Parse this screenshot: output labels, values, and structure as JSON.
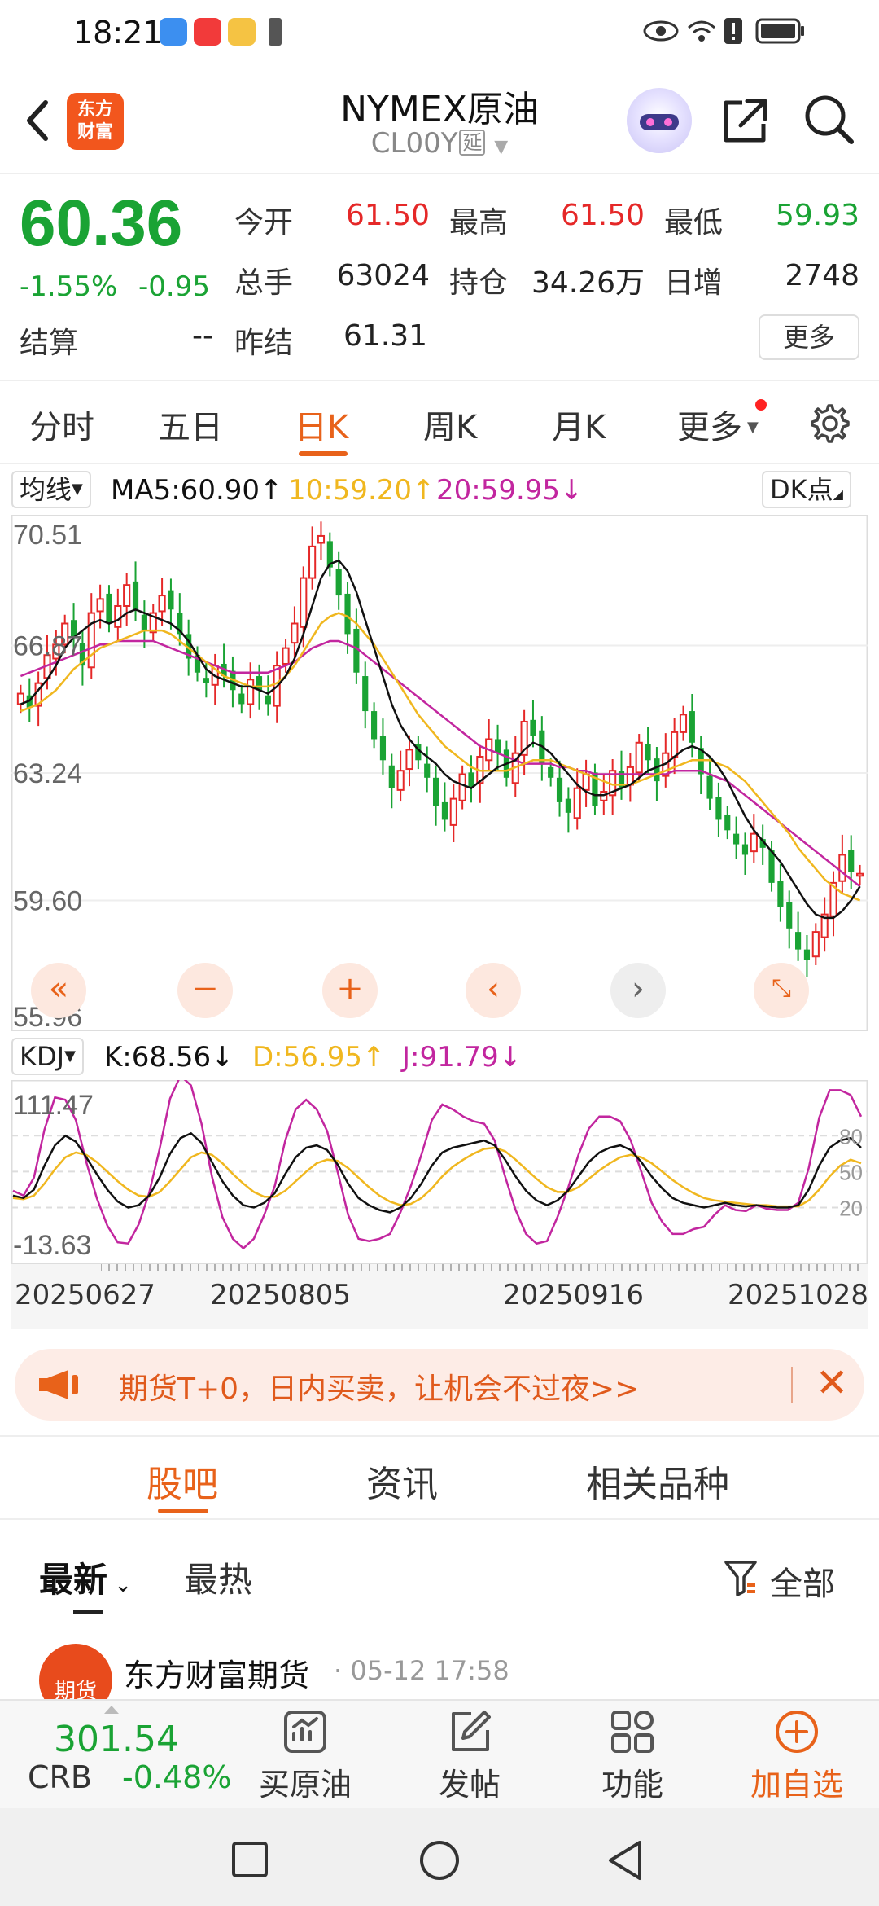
{
  "status_bar": {
    "time": "18:21",
    "app_icons": [
      "maps-app-icon",
      "xiaohongshu-app-icon",
      "xiaohongshu-app-icon",
      "weibo-app-icon",
      "sim-icon"
    ],
    "right_icons": [
      "eye-icon",
      "wifi-icon",
      "alert-icon",
      "battery-icon"
    ]
  },
  "header": {
    "logo_text_1": "东方",
    "logo_text_2": "财富",
    "title": "NYMEX原油",
    "code": "CL00Y",
    "delay_tag": "延"
  },
  "quote": {
    "price": "60.36",
    "change_pct": "-1.55%",
    "change": "-0.95",
    "open_label": "今开",
    "open": "61.50",
    "high_label": "最高",
    "high": "61.50",
    "low_label": "最低",
    "low": "59.93",
    "volume_label": "总手",
    "volume": "63024",
    "oi_label": "持仓",
    "oi": "34.26万",
    "oi_change_label": "日增",
    "oi_change": "2748",
    "settle_label": "结算",
    "settle": "--",
    "prev_settle_label": "昨结",
    "prev_settle": "61.31",
    "more_label": "更多"
  },
  "period_tabs": [
    {
      "label": "分时"
    },
    {
      "label": "五日"
    },
    {
      "label": "日K"
    },
    {
      "label": "周K"
    },
    {
      "label": "月K"
    },
    {
      "label": "更多"
    }
  ],
  "active_period": "日K",
  "ma_row": {
    "selector": "均线",
    "ma5": "MA5:60.90↑",
    "ma10": "10:59.20↑",
    "ma20": "20:59.95↓",
    "dk": "DK点"
  },
  "kdj_row": {
    "selector": "KDJ",
    "k": "K:68.56↓",
    "d": "D:56.95↑",
    "j": "J:91.79↓"
  },
  "chart_labels": {
    "price_ticks": [
      "70.51",
      "66.87",
      "63.24",
      "59.60",
      "55.96"
    ],
    "kdj_ticks_left": [
      "111.47",
      "-13.63"
    ],
    "kdj_ticks_right": [
      "80",
      "50",
      "20"
    ],
    "dates": [
      "20250627",
      "20250805",
      "20250916",
      "20251028"
    ]
  },
  "colors": {
    "up": "#e52828",
    "down": "#1aa334",
    "ma5": "#111111",
    "ma10": "#f0b71f",
    "ma20": "#c2269f",
    "accent": "#e8621a"
  },
  "chart_data": [
    {
      "type": "candlestick",
      "title": "",
      "ylim": [
        55.96,
        70.51
      ],
      "x_labels": [
        "20250627",
        "20250805",
        "20250916",
        "20251028"
      ],
      "close": [
        65.5,
        65.1,
        65.8,
        66.6,
        66.9,
        67.5,
        67.1,
        66.3,
        67.8,
        68.2,
        67.5,
        68.0,
        68.6,
        67.9,
        67.3,
        67.8,
        68.3,
        67.9,
        67.2,
        66.5,
        66.1,
        65.8,
        66.3,
        66.0,
        65.6,
        65.2,
        65.9,
        65.6,
        65.2,
        66.3,
        66.8,
        67.5,
        68.8,
        69.7,
        70.0,
        69.1,
        68.3,
        67.2,
        66.1,
        65.0,
        64.2,
        63.6,
        62.8,
        63.3,
        63.9,
        63.6,
        63.1,
        62.3,
        61.9,
        62.5,
        63.2,
        62.8,
        63.7,
        64.2,
        63.8,
        63.1,
        63.8,
        64.7,
        64.3,
        63.5,
        63.1,
        62.4,
        62.1,
        62.8,
        63.2,
        62.3,
        62.7,
        63.3,
        62.8,
        63.4,
        64.1,
        63.6,
        63.0,
        63.8,
        64.4,
        64.9,
        64.1,
        63.2,
        62.5,
        61.9,
        61.6,
        61.2,
        60.9,
        61.5,
        61.1,
        60.1,
        59.4,
        58.8,
        58.2,
        57.9,
        58.7,
        59.2,
        60.1,
        60.9,
        60.4,
        60.36
      ],
      "ma5": [
        65.2,
        65.3,
        65.6,
        65.9,
        66.3,
        66.8,
        67.1,
        67.3,
        67.5,
        67.6,
        67.5,
        67.6,
        67.8,
        67.9,
        67.8,
        67.7,
        67.6,
        67.5,
        67.3,
        67.0,
        66.6,
        66.2,
        66.0,
        65.9,
        65.8,
        65.7,
        65.7,
        65.6,
        65.5,
        65.7,
        66.0,
        66.5,
        67.2,
        68.0,
        68.8,
        69.2,
        69.3,
        69.0,
        68.4,
        67.6,
        66.8,
        66.0,
        65.2,
        64.6,
        64.2,
        63.9,
        63.7,
        63.5,
        63.2,
        63.0,
        62.9,
        62.8,
        63.0,
        63.2,
        63.4,
        63.5,
        63.6,
        63.9,
        64.1,
        64.0,
        63.8,
        63.5,
        63.2,
        62.9,
        62.7,
        62.6,
        62.6,
        62.7,
        62.8,
        62.9,
        63.1,
        63.3,
        63.4,
        63.5,
        63.7,
        63.9,
        64.0,
        63.9,
        63.7,
        63.4,
        63.0,
        62.5,
        62.0,
        61.6,
        61.3,
        61.0,
        60.7,
        60.3,
        59.9,
        59.5,
        59.2,
        59.1,
        59.1,
        59.3,
        59.6,
        60.0
      ],
      "ma10": [
        65.0,
        65.1,
        65.2,
        65.4,
        65.6,
        65.9,
        66.2,
        66.4,
        66.6,
        66.8,
        66.9,
        67.0,
        67.1,
        67.2,
        67.3,
        67.3,
        67.3,
        67.2,
        67.0,
        66.8,
        66.6,
        66.4,
        66.2,
        66.0,
        65.9,
        65.8,
        65.7,
        65.7,
        65.7,
        65.8,
        66.0,
        66.3,
        66.7,
        67.1,
        67.5,
        67.7,
        67.8,
        67.7,
        67.5,
        67.2,
        66.9,
        66.5,
        66.1,
        65.7,
        65.3,
        64.9,
        64.6,
        64.3,
        64.0,
        63.8,
        63.6,
        63.4,
        63.3,
        63.3,
        63.3,
        63.3,
        63.4,
        63.5,
        63.6,
        63.6,
        63.6,
        63.5,
        63.4,
        63.3,
        63.2,
        63.1,
        63.0,
        62.9,
        62.9,
        62.9,
        63.0,
        63.1,
        63.2,
        63.3,
        63.4,
        63.5,
        63.6,
        63.6,
        63.6,
        63.5,
        63.4,
        63.2,
        63.0,
        62.7,
        62.4,
        62.1,
        61.8,
        61.5,
        61.1,
        60.8,
        60.5,
        60.2,
        60.0,
        59.8,
        59.7,
        59.6
      ],
      "ma20": [
        66.0,
        66.1,
        66.2,
        66.3,
        66.4,
        66.5,
        66.6,
        66.7,
        66.8,
        66.9,
        66.9,
        67.0,
        67.0,
        67.0,
        67.0,
        67.0,
        66.9,
        66.8,
        66.7,
        66.6,
        66.5,
        66.4,
        66.3,
        66.2,
        66.1,
        66.1,
        66.1,
        66.1,
        66.1,
        66.2,
        66.3,
        66.4,
        66.6,
        66.8,
        66.9,
        67.0,
        67.0,
        66.9,
        66.8,
        66.6,
        66.4,
        66.2,
        66.0,
        65.8,
        65.6,
        65.4,
        65.2,
        65.0,
        64.8,
        64.6,
        64.4,
        64.2,
        64.0,
        63.9,
        63.8,
        63.7,
        63.6,
        63.5,
        63.5,
        63.5,
        63.5,
        63.4,
        63.4,
        63.3,
        63.3,
        63.2,
        63.2,
        63.2,
        63.2,
        63.2,
        63.2,
        63.2,
        63.2,
        63.2,
        63.3,
        63.3,
        63.3,
        63.3,
        63.2,
        63.1,
        63.0,
        62.8,
        62.6,
        62.4,
        62.2,
        62.0,
        61.8,
        61.6,
        61.4,
        61.2,
        61.0,
        60.8,
        60.6,
        60.4,
        60.2,
        60.0
      ]
    },
    {
      "type": "line",
      "title": "KDJ",
      "ylim": [
        -13.63,
        111.47
      ],
      "series": [
        {
          "name": "K",
          "values": [
            30,
            28,
            35,
            55,
            72,
            80,
            75,
            62,
            48,
            35,
            25,
            20,
            22,
            30,
            45,
            65,
            78,
            82,
            74,
            58,
            42,
            30,
            22,
            20,
            24,
            32,
            48,
            62,
            70,
            72,
            68,
            56,
            40,
            28,
            22,
            18,
            16,
            20,
            28,
            40,
            55,
            66,
            70,
            72,
            74,
            76,
            72,
            60,
            46,
            34,
            26,
            22,
            26,
            34,
            46,
            58,
            66,
            70,
            72,
            68,
            58,
            46,
            36,
            28,
            24,
            22,
            20,
            22,
            24,
            22,
            21,
            22,
            21,
            20,
            20,
            22,
            35,
            55,
            70,
            76,
            78,
            70
          ]
        },
        {
          "name": "D",
          "values": [
            28,
            27,
            30,
            40,
            52,
            62,
            66,
            64,
            58,
            50,
            42,
            35,
            30,
            29,
            33,
            42,
            52,
            62,
            66,
            64,
            57,
            48,
            40,
            33,
            29,
            29,
            34,
            42,
            50,
            57,
            60,
            59,
            53,
            45,
            37,
            30,
            25,
            22,
            23,
            28,
            36,
            46,
            54,
            60,
            65,
            69,
            70,
            67,
            60,
            52,
            44,
            37,
            33,
            33,
            37,
            44,
            51,
            57,
            62,
            64,
            62,
            57,
            50,
            43,
            37,
            32,
            28,
            26,
            25,
            24,
            23,
            22,
            22,
            21,
            21,
            21,
            26,
            35,
            46,
            55,
            60,
            57
          ]
        },
        {
          "name": "J",
          "values": [
            34,
            30,
            45,
            85,
            112,
            110,
            93,
            58,
            28,
            5,
            -9,
            -10,
            6,
            32,
            69,
            111,
            130,
            122,
            90,
            46,
            12,
            -6,
            -14,
            -6,
            14,
            38,
            76,
            102,
            110,
            102,
            84,
            50,
            14,
            -6,
            -8,
            -6,
            -2,
            16,
            38,
            64,
            93,
            106,
            102,
            96,
            92,
            90,
            76,
            46,
            18,
            -2,
            -10,
            -8,
            12,
            36,
            64,
            86,
            96,
            96,
            92,
            76,
            50,
            24,
            8,
            -2,
            -2,
            2,
            4,
            14,
            22,
            18,
            17,
            22,
            19,
            18,
            18,
            24,
            53,
            95,
            118,
            118,
            114,
            96
          ]
        }
      ]
    }
  ],
  "banner": {
    "text": "期货T+0，日内买卖，让机会不过夜>>"
  },
  "section_tabs": [
    {
      "label": "股吧"
    },
    {
      "label": "资讯"
    },
    {
      "label": "相关品种"
    }
  ],
  "filter": {
    "latest": "最新",
    "hottest": "最热",
    "all": "全部"
  },
  "feed": {
    "author": "东方财富期货",
    "time": "· 05-12 17:58",
    "avatar_text": "期货"
  },
  "bottom_bar": {
    "crb_value": "301.54",
    "crb_label": "CRB",
    "crb_change": "-0.48%",
    "buy_label": "买原油",
    "post_label": "发帖",
    "func_label": "功能",
    "add_label": "加自选"
  }
}
